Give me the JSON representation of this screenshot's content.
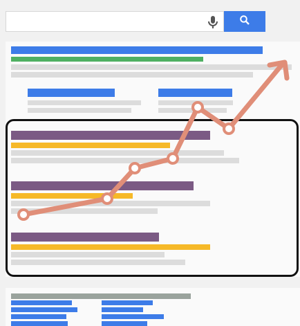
{
  "search": {
    "placeholder": "",
    "value": ""
  },
  "icons": {
    "mic": "microphone-icon",
    "search": "magnifier-icon"
  },
  "colors": {
    "accent_blue": "#3d7ce8",
    "green": "#4fb062",
    "purple": "#7b5a84",
    "yellow": "#f6b928",
    "trend": "#e08e78"
  }
}
